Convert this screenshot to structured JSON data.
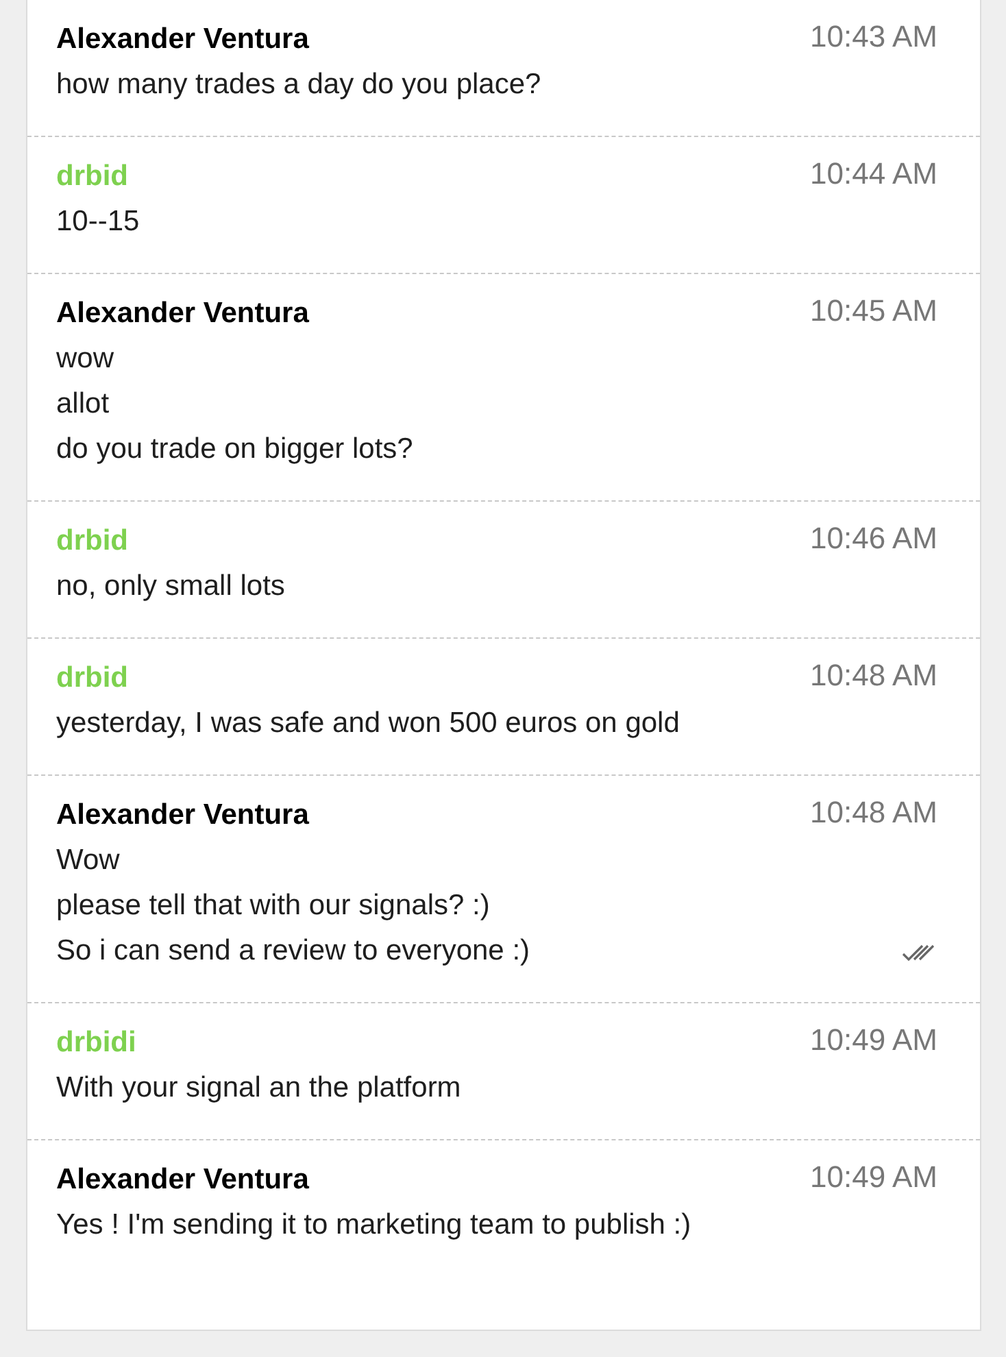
{
  "messages": [
    {
      "sender": "Alexander Ventura",
      "kind": "self",
      "time": "10:43 AM",
      "lines": [
        "how many trades a day do you place?"
      ],
      "read": false
    },
    {
      "sender": "drbid",
      "kind": "contact",
      "time": "10:44 AM",
      "lines": [
        "10--15"
      ],
      "read": false
    },
    {
      "sender": "Alexander Ventura",
      "kind": "self",
      "time": "10:45 AM",
      "lines": [
        "wow",
        "allot",
        "do you trade on bigger lots?"
      ],
      "read": false
    },
    {
      "sender": "drbid",
      "kind": "contact",
      "time": "10:46 AM",
      "lines": [
        "no, only small lots"
      ],
      "read": false
    },
    {
      "sender": "drbid",
      "kind": "contact",
      "time": "10:48 AM",
      "lines": [
        "yesterday, I was safe and won 500 euros on gold"
      ],
      "read": false
    },
    {
      "sender": "Alexander Ventura",
      "kind": "self",
      "time": "10:48 AM",
      "lines": [
        "Wow",
        "please tell that with our signals? :)",
        "So i can send a review to everyone :)"
      ],
      "read": true
    },
    {
      "sender": "drbidi",
      "kind": "contact",
      "time": "10:49 AM",
      "lines": [
        "With your signal an the platform"
      ],
      "read": false
    },
    {
      "sender": "Alexander Ventura",
      "kind": "self",
      "time": "10:49 AM",
      "lines": [
        "Yes ! I'm sending it to marketing team to publish :)"
      ],
      "read": false
    }
  ]
}
